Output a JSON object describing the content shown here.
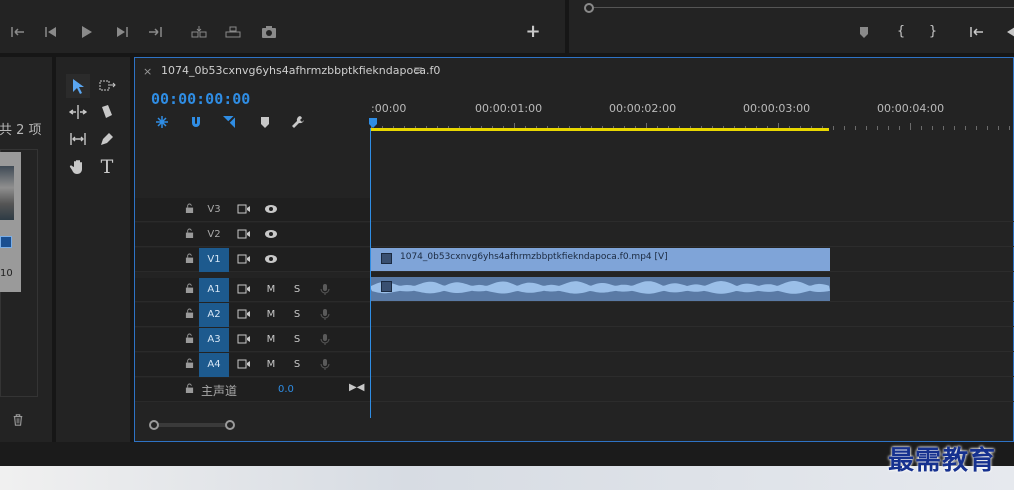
{
  "source_monitor": {
    "controls": [
      "mark-in-icon",
      "mark-out-icon",
      "step-back-icon",
      "play-icon",
      "step-forward-icon",
      "go-to-out-icon",
      "insert-icon",
      "overwrite-icon",
      "export-frame-icon"
    ],
    "add_button_label": "+"
  },
  "program_monitor": {
    "controls": [
      "add-marker-icon",
      "mark-in-icon",
      "mark-out-icon",
      "go-to-in-icon",
      "step-back-icon"
    ],
    "mark_in_glyph": "{",
    "mark_out_glyph": "}"
  },
  "project": {
    "count_label": "共 2 项",
    "thumb_label": "10",
    "trash_icon": "trash-icon"
  },
  "tools": [
    "selection-tool",
    "track-select-tool",
    "ripple-edit-tool",
    "razor-tool",
    "slip-tool",
    "pen-tool",
    "hand-tool",
    "type-tool"
  ],
  "timeline": {
    "tab_close": "×",
    "sequence_title": "1074_0b53cxnvg6yhs4afhrmzbbptkfiekndapoca.f0",
    "menu_glyph": "≡",
    "timecode": "00:00:00:00",
    "ruler_labels": [
      ":00:00",
      "00:00:01:00",
      "00:00:02:00",
      "00:00:03:00",
      "00:00:04:00"
    ],
    "tracks": [
      {
        "name": "V3",
        "type": "video",
        "active": false
      },
      {
        "name": "V2",
        "type": "video",
        "active": false
      },
      {
        "name": "V1",
        "type": "video",
        "active": true
      },
      {
        "name": "A1",
        "type": "audio",
        "active": true
      },
      {
        "name": "A2",
        "type": "audio",
        "active": true
      },
      {
        "name": "A3",
        "type": "audio",
        "active": true
      },
      {
        "name": "A4",
        "type": "audio",
        "active": true
      }
    ],
    "mute_label": "M",
    "solo_label": "S",
    "master_label": "主声道",
    "master_value": "0.0",
    "video_clip_label": "1074_0b53cxnvg6yhs4afhrmzbbptkfiekndapoca.f0.mp4 [V]",
    "colors": {
      "accent": "#2f8de4",
      "clip_video": "#7fa4d8",
      "clip_audio": "#5a7aa5",
      "work_area": "#e8d700",
      "track_target": "#1d5a8e"
    }
  },
  "watermark": "最需教育"
}
